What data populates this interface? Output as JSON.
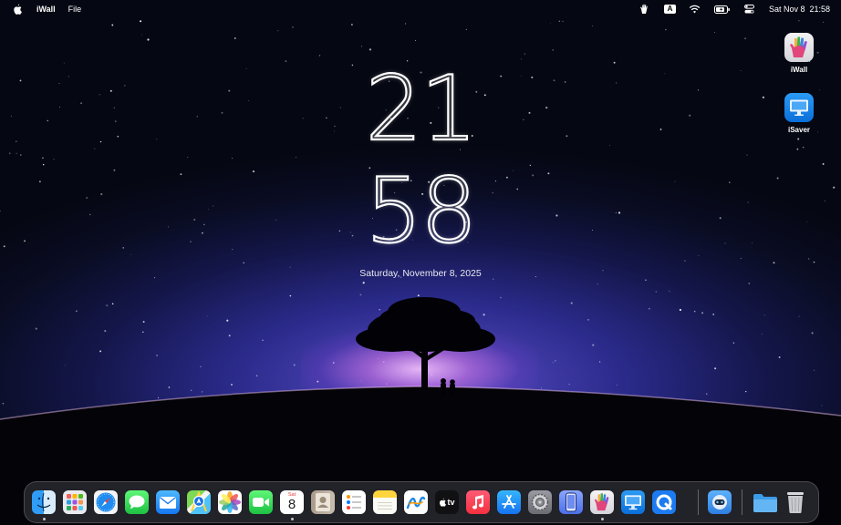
{
  "menubar": {
    "apple_icon": "apple-logo-icon",
    "app_name": "iWall",
    "menus": [
      "File"
    ],
    "status_icons": [
      "hand-icon",
      "input-source-icon",
      "wifi-icon",
      "battery-icon",
      "control-center-icon"
    ],
    "input_source_label": "A",
    "datetime": "Sat Nov 8  21:58"
  },
  "clock": {
    "hours": "21",
    "minutes": "58",
    "date": "Saturday, November 8, 2025"
  },
  "desktop_icons": [
    {
      "label": "iWall",
      "icon": "iwall-hand-icon"
    },
    {
      "label": "iSaver",
      "icon": "isaver-monitor-icon"
    }
  ],
  "dock": {
    "apps": [
      {
        "name": "Finder",
        "icon": "finder-icon",
        "running": true
      },
      {
        "name": "Launchpad",
        "icon": "launchpad-icon",
        "running": false
      },
      {
        "name": "Safari",
        "icon": "safari-icon",
        "running": false
      },
      {
        "name": "Messages",
        "icon": "messages-icon",
        "running": false
      },
      {
        "name": "Mail",
        "icon": "mail-icon",
        "running": false
      },
      {
        "name": "Maps",
        "icon": "maps-icon",
        "running": false
      },
      {
        "name": "Photos",
        "icon": "photos-icon",
        "running": false
      },
      {
        "name": "FaceTime",
        "icon": "facetime-icon",
        "running": false
      },
      {
        "name": "Calendar",
        "icon": "calendar-icon",
        "running": true
      },
      {
        "name": "Contacts",
        "icon": "contacts-icon",
        "running": false
      },
      {
        "name": "Reminders",
        "icon": "reminders-icon",
        "running": false
      },
      {
        "name": "Notes",
        "icon": "notes-icon",
        "running": false
      },
      {
        "name": "Freeform",
        "icon": "freeform-icon",
        "running": false
      },
      {
        "name": "TV",
        "icon": "apple-tv-icon",
        "running": false
      },
      {
        "name": "Music",
        "icon": "music-icon",
        "running": false
      },
      {
        "name": "App Store",
        "icon": "app-store-icon",
        "running": false
      },
      {
        "name": "System Settings",
        "icon": "system-settings-icon",
        "running": false
      },
      {
        "name": "iPhone Mirroring",
        "icon": "iphone-mirroring-icon",
        "running": false
      },
      {
        "name": "iWall",
        "icon": "iwall-hand-icon",
        "running": true
      },
      {
        "name": "iSaver",
        "icon": "isaver-monitor-icon",
        "running": false
      },
      {
        "name": "QReate",
        "icon": "q-app-icon",
        "running": false
      }
    ],
    "extras": [
      {
        "name": "Robot",
        "icon": "robot-app-icon"
      },
      {
        "name": "Downloads",
        "icon": "folder-icon"
      },
      {
        "name": "Trash",
        "icon": "trash-icon"
      }
    ],
    "calendar_month": "Sat",
    "calendar_day": "8",
    "tv_label": "tv"
  }
}
